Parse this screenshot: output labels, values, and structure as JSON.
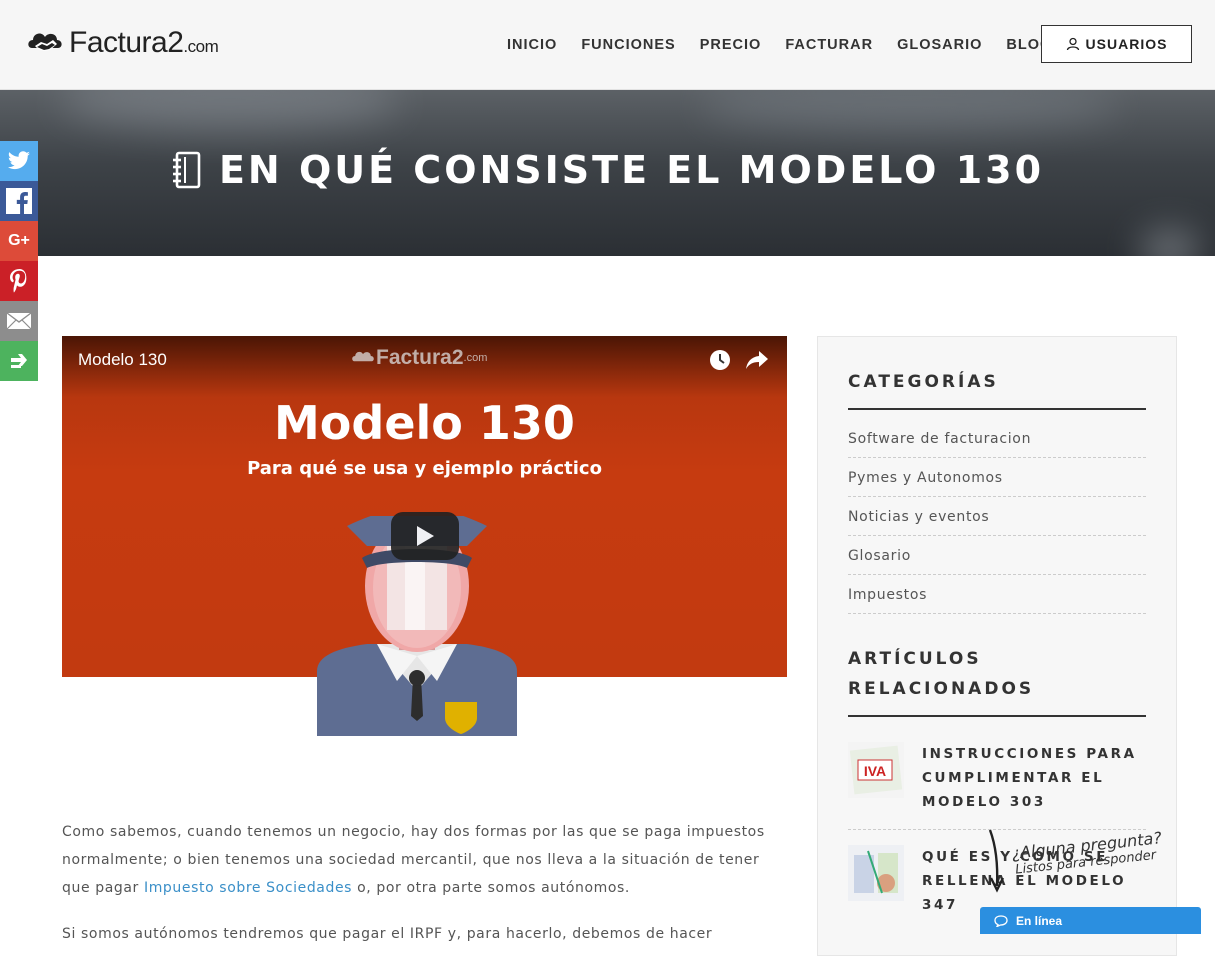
{
  "header": {
    "logo_text": "Factura2",
    "logo_suffix": ".com",
    "nav": [
      "INICIO",
      "FUNCIONES",
      "PRECIO",
      "FACTURAR",
      "GLOSARIO",
      "BLOG"
    ],
    "user_button": "USUARIOS"
  },
  "hero": {
    "title": "EN QUÉ CONSISTE EL MODELO 130"
  },
  "share": {
    "icons": [
      "twitter-icon",
      "facebook-icon",
      "google-plus-icon",
      "pinterest-icon",
      "email-icon",
      "more-share-icon"
    ],
    "colors": [
      "#55acee",
      "#3b5998",
      "#dd4b39",
      "#cb2027",
      "#8d8d8d",
      "#4db35e"
    ],
    "google_label": "G+"
  },
  "video": {
    "title": "Modelo 130",
    "logo_text": "Factura2",
    "logo_suffix": ".com",
    "slide_title": "Modelo 130",
    "slide_subtitle": "Para qué se usa y ejemplo práctico"
  },
  "article": {
    "p1_before": "Como sabemos, cuando tenemos un negocio, hay dos formas por las que se paga impuestos normalmente; o bien tenemos una sociedad mercantil, que nos lleva a la situación de tener que pagar ",
    "p1_link": "Impuesto sobre Sociedades",
    "p1_after": " o, por otra parte somos autónomos.",
    "p2": "Si somos autónomos tendremos que pagar el IRPF y, para hacerlo, debemos de hacer"
  },
  "sidebar": {
    "categories_title": "CATEGORÍAS",
    "categories": [
      "Software de facturacion",
      "Pymes y Autonomos",
      "Noticias y eventos",
      "Glosario",
      "Impuestos"
    ],
    "related_title_1": "ARTÍCULOS",
    "related_title_2": "RELACIONADOS",
    "related": [
      {
        "title": "INSTRUCCIONES PARA CUMPLIMENTAR EL MODELO 303",
        "thumb_label": "IVA"
      },
      {
        "title": "QUÉ ES Y CÓMO SE RELLENA EL MODELO 347"
      }
    ]
  },
  "chat": {
    "question": "¿Alguna pregunta?",
    "subtitle": "Listos para responder",
    "status": "En línea"
  }
}
